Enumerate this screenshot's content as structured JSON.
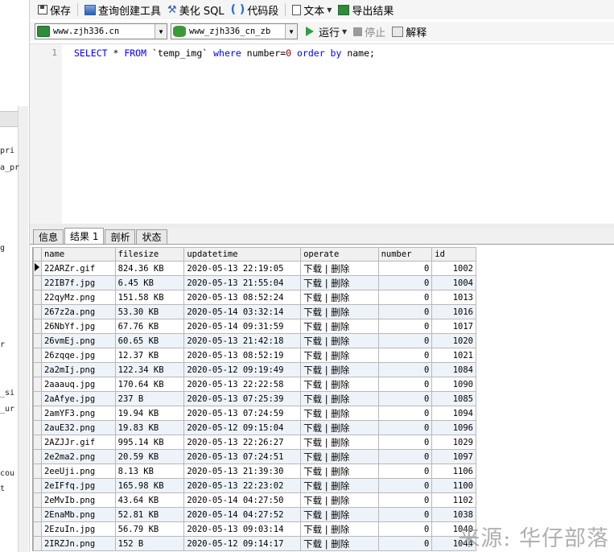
{
  "toolbar": {
    "save_label": "保存",
    "query_builder_label": "查询创建工具",
    "beautify_label": "美化 SQL",
    "snippet_label": "代码段",
    "text_label": "文本",
    "export_label": "导出结果"
  },
  "connection": {
    "server_value": "www.zjh336.cn",
    "database_value": "www_zjh336_cn_zb",
    "run_label": "运行",
    "stop_label": "停止",
    "explain_label": "解释"
  },
  "editor": {
    "line_number": "1",
    "sql": {
      "select": "SELECT",
      "star": " * ",
      "from": "FROM",
      "table": " `temp_img` ",
      "where": "where",
      "cond_field": " number=",
      "cond_value": "0",
      "order": " order",
      "by": " by",
      "order_field": " name;"
    }
  },
  "left_gutter": {
    "fragments": [
      "pri",
      "a_pr",
      "g",
      "r",
      "_si",
      "_ur",
      "cou",
      "t"
    ]
  },
  "tabs": [
    "信息",
    "结果 1",
    "剖析",
    "状态"
  ],
  "grid": {
    "columns": [
      "name",
      "filesize",
      "updatetime",
      "operate",
      "number",
      "id"
    ],
    "rows": [
      {
        "name": "22ARZr.gif",
        "filesize": "824.36 KB",
        "updatetime": "2020-05-13 22:19:05",
        "operate": "下载 | 删除",
        "number": "0",
        "id": "1002"
      },
      {
        "name": "22IB7f.jpg",
        "filesize": "6.45 KB",
        "updatetime": "2020-05-13 21:55:04",
        "operate": "下载 | 删除",
        "number": "0",
        "id": "1004"
      },
      {
        "name": "22qyMz.png",
        "filesize": "151.58 KB",
        "updatetime": "2020-05-13 08:52:24",
        "operate": "下载 | 删除",
        "number": "0",
        "id": "1013"
      },
      {
        "name": "267z2a.png",
        "filesize": "53.30 KB",
        "updatetime": "2020-05-14 03:32:14",
        "operate": "下载 | 删除",
        "number": "0",
        "id": "1016"
      },
      {
        "name": "26NbYf.jpg",
        "filesize": "67.76 KB",
        "updatetime": "2020-05-14 09:31:59",
        "operate": "下载 | 删除",
        "number": "0",
        "id": "1017"
      },
      {
        "name": "26vmEj.png",
        "filesize": "60.65 KB",
        "updatetime": "2020-05-13 21:42:18",
        "operate": "下载 | 删除",
        "number": "0",
        "id": "1020"
      },
      {
        "name": "26zqqe.jpg",
        "filesize": "12.37 KB",
        "updatetime": "2020-05-13 08:52:19",
        "operate": "下载 | 删除",
        "number": "0",
        "id": "1021"
      },
      {
        "name": "2a2mIj.png",
        "filesize": "122.34 KB",
        "updatetime": "2020-05-12 09:19:49",
        "operate": "下载 | 删除",
        "number": "0",
        "id": "1084"
      },
      {
        "name": "2aaauq.jpg",
        "filesize": "170.64 KB",
        "updatetime": "2020-05-13 22:22:58",
        "operate": "下载 | 删除",
        "number": "0",
        "id": "1090"
      },
      {
        "name": "2aAfye.jpg",
        "filesize": "237 B",
        "updatetime": "2020-05-13 07:25:39",
        "operate": "下载 | 删除",
        "number": "0",
        "id": "1085"
      },
      {
        "name": "2amYF3.png",
        "filesize": "19.94 KB",
        "updatetime": "2020-05-13 07:24:59",
        "operate": "下载 | 删除",
        "number": "0",
        "id": "1094"
      },
      {
        "name": "2auE32.png",
        "filesize": "19.83 KB",
        "updatetime": "2020-05-12 09:15:04",
        "operate": "下载 | 删除",
        "number": "0",
        "id": "1096"
      },
      {
        "name": "2AZJJr.gif",
        "filesize": "995.14 KB",
        "updatetime": "2020-05-13 22:26:27",
        "operate": "下载 | 删除",
        "number": "0",
        "id": "1029"
      },
      {
        "name": "2e2ma2.png",
        "filesize": "20.59 KB",
        "updatetime": "2020-05-13 07:24:51",
        "operate": "下载 | 删除",
        "number": "0",
        "id": "1097"
      },
      {
        "name": "2eeUji.png",
        "filesize": "8.13 KB",
        "updatetime": "2020-05-13 21:39:30",
        "operate": "下载 | 删除",
        "number": "0",
        "id": "1106"
      },
      {
        "name": "2eIFfq.jpg",
        "filesize": "165.98 KB",
        "updatetime": "2020-05-13 22:23:02",
        "operate": "下载 | 删除",
        "number": "0",
        "id": "1100"
      },
      {
        "name": "2eMvIb.png",
        "filesize": "43.64 KB",
        "updatetime": "2020-05-14 04:27:50",
        "operate": "下载 | 删除",
        "number": "0",
        "id": "1102"
      },
      {
        "name": "2EnaMb.png",
        "filesize": "52.81 KB",
        "updatetime": "2020-05-14 04:27:52",
        "operate": "下载 | 删除",
        "number": "0",
        "id": "1038"
      },
      {
        "name": "2EzuIn.jpg",
        "filesize": "56.79 KB",
        "updatetime": "2020-05-13 09:03:14",
        "operate": "下载 | 删除",
        "number": "0",
        "id": "1040"
      },
      {
        "name": "2IRZJn.png",
        "filesize": "152 B",
        "updatetime": "2020-05-12 09:14:17",
        "operate": "下载 | 删除",
        "number": "0",
        "id": "1044"
      }
    ]
  },
  "watermark": "来源: 华仔部落",
  "colors": {
    "keyword": "#0000ff",
    "number_literal": "#880000",
    "run_icon": "#2ea043",
    "alt_row": "#eef3fa"
  }
}
